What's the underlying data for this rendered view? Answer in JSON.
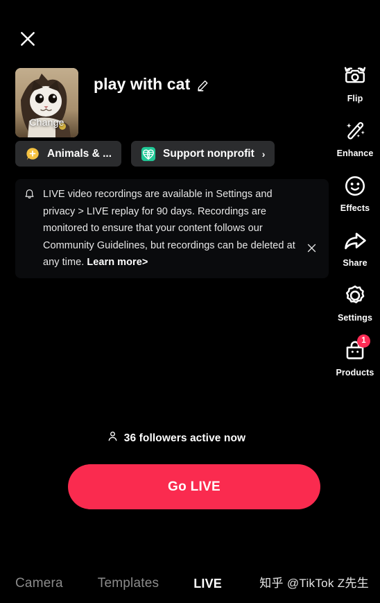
{
  "app": {
    "screen_name": "LIVE setup",
    "background_color": "#000000",
    "accent_color": "#fa2b4f"
  },
  "close_button": {
    "icon": "close-icon",
    "label": "Close"
  },
  "header": {
    "thumbnail": {
      "icon": "cat-thumbnail",
      "change_label": "Change",
      "alt": "kitten photo"
    },
    "title": "play with cat",
    "edit_icon": "pencil-edit-icon"
  },
  "chips": [
    {
      "label": "Animals & ...",
      "icon": "topic-bubble-icon",
      "icon_color": "#f5c242",
      "chevron": ""
    },
    {
      "label": "Support nonprofit",
      "icon": "globe-heart-icon",
      "icon_color": "#20c997",
      "chevron": "›"
    }
  ],
  "notice": {
    "icon": "bell-icon",
    "text": "LIVE video recordings are available in Settings and privacy > LIVE replay for 90 days. Recordings are monitored to ensure that your content follows our Community Guidelines, but recordings can be deleted at any time. ",
    "link_text": "Learn more>",
    "close_icon": "close-icon"
  },
  "rail": {
    "items": [
      {
        "label": "Flip",
        "icon": "camera-flip-icon"
      },
      {
        "label": "Enhance",
        "icon": "magic-wand-icon"
      },
      {
        "label": "Effects",
        "icon": "smiley-face-icon"
      },
      {
        "label": "Share",
        "icon": "share-arrow-icon"
      },
      {
        "label": "Settings",
        "icon": "gear-icon"
      },
      {
        "label": "Products",
        "icon": "shopping-bag-icon",
        "badge": "1"
      }
    ]
  },
  "followers": {
    "icon": "person-icon",
    "text": "36 followers active now",
    "count": 36
  },
  "go_live_button": {
    "label": "Go LIVE"
  },
  "tabs": [
    {
      "label": "Camera",
      "active": false
    },
    {
      "label": "Templates",
      "active": false
    },
    {
      "label": "LIVE",
      "active": true
    }
  ],
  "watermark": "知乎 @TikTok Z先生"
}
